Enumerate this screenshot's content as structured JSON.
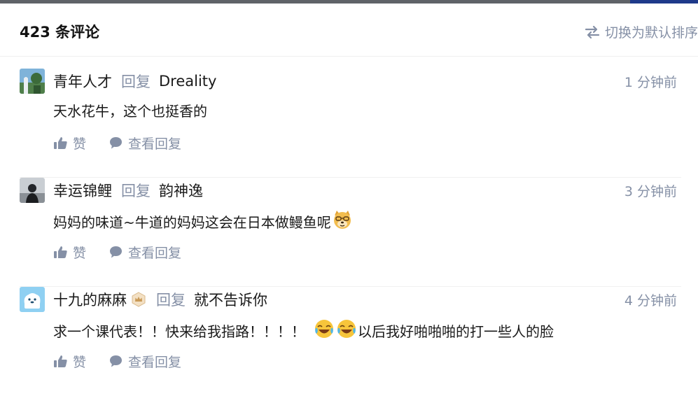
{
  "header": {
    "count_label": "423 条评论",
    "sort_label": "切换为默认排序"
  },
  "comments": [
    {
      "author": "青年人才",
      "reply_word": "回复",
      "reply_to": "Dreality",
      "time": "1 分钟前",
      "text": "天水花牛，这个也挺香的",
      "like_label": "赞",
      "view_replies_label": "查看回复"
    },
    {
      "author": "幸运锦鲤",
      "reply_word": "回复",
      "reply_to": "韵神逸",
      "time": "3 分钟前",
      "text": "妈妈的味道~牛道的妈妈这会在日本做鳗鱼呢",
      "emoji": "doge-emoji",
      "like_label": "赞",
      "view_replies_label": "查看回复"
    },
    {
      "author": "十九的麻麻",
      "reply_word": "回复",
      "reply_to": "就不告诉你",
      "time": "4 分钟前",
      "text_before": "求一个课代表！！快来给我指路！！！！",
      "text_after": "以后我好啪啪啪的打一些人的脸",
      "emoji": "laugh-cry-emoji",
      "like_label": "赞",
      "view_replies_label": "查看回复"
    }
  ],
  "colors": {
    "muted": "#8590a6",
    "text": "#1a1a1a",
    "divider": "#f0f0f0"
  }
}
